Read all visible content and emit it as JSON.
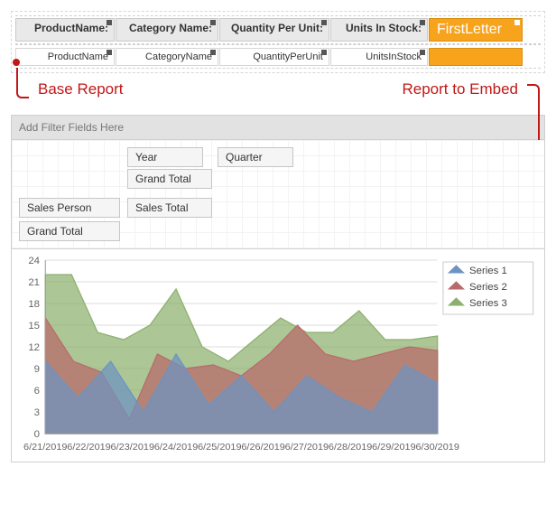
{
  "colors": {
    "callout": "#c21717",
    "embed_bg": "#f7a31c",
    "series1": "#6e93c0",
    "series2": "#b96a6a",
    "series3": "#8cb06d"
  },
  "top_designer": {
    "headers": {
      "product_name": "ProductName:",
      "category_name": "Category Name:",
      "quantity_per_unit": "Quantity Per Unit:",
      "units_in_stock": "Units In Stock:"
    },
    "fields": {
      "product_name": "ProductName",
      "category_name": "CategoryName",
      "quantity_per_unit": "QuantityPerUnit",
      "units_in_stock": "UnitsInStock"
    },
    "embed_label": "FirstLetter"
  },
  "callouts": {
    "base_report": "Base Report",
    "embed_report": "Report to Embed"
  },
  "bottom_designer": {
    "filter_placeholder": "Add Filter Fields Here",
    "pivot": {
      "year": "Year",
      "quarter": "Quarter",
      "grand_total_row": "Grand Total",
      "sales_person": "Sales Person",
      "sales_total": "Sales Total",
      "grand_total_col": "Grand Total"
    }
  },
  "chart_data": {
    "type": "area",
    "title": "",
    "xlabel": "",
    "ylabel": "",
    "ylim": [
      0,
      24
    ],
    "yticks": [
      0,
      3,
      6,
      9,
      12,
      15,
      18,
      21,
      24
    ],
    "x": [
      "6/21/2019",
      "6/22/2019",
      "6/23/2019",
      "6/24/2019",
      "6/25/2019",
      "6/26/2019",
      "6/27/2019",
      "6/28/2019",
      "6/29/2019",
      "6/30/2019"
    ],
    "series": [
      {
        "name": "Series 1",
        "values": [
          10,
          5,
          10,
          3,
          11,
          4,
          8,
          3,
          8,
          5,
          3,
          9.5,
          7
        ]
      },
      {
        "name": "Series 2",
        "values": [
          16,
          10,
          8.5,
          2,
          11,
          9,
          9.5,
          8,
          11,
          15,
          11,
          10,
          11,
          12,
          11.5
        ]
      },
      {
        "name": "Series 3",
        "values": [
          22,
          22,
          14,
          13,
          15,
          20,
          12,
          10,
          13,
          16,
          14,
          14,
          17,
          13,
          13,
          13.5
        ]
      }
    ],
    "legend": [
      "Series 1",
      "Series 2",
      "Series 3"
    ]
  }
}
